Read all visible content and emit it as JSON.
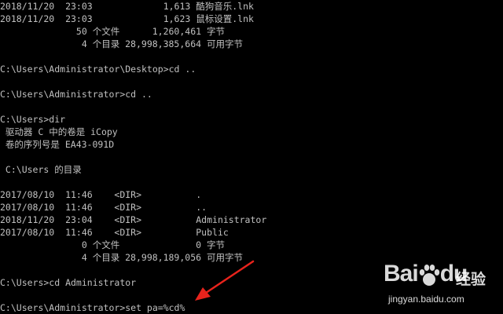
{
  "console": {
    "lines": [
      {
        "text": "2018/11/20  23:03             1,613 酷狗音乐.lnk"
      },
      {
        "text": "2018/11/20  23:03             1,623 鼠标设置.lnk"
      },
      {
        "text": "              50 个文件      1,260,461 字节"
      },
      {
        "text": "               4 个目录 28,998,385,664 可用字节"
      },
      {
        "text": ""
      },
      {
        "text": "C:\\Users\\Administrator\\Desktop>cd .."
      },
      {
        "text": ""
      },
      {
        "text": "C:\\Users\\Administrator>cd .."
      },
      {
        "text": ""
      },
      {
        "text": "C:\\Users>dir"
      },
      {
        "text": " 驱动器 C 中的卷是 iCopy"
      },
      {
        "text": " 卷的序列号是 EA43-091D"
      },
      {
        "text": ""
      },
      {
        "text": " C:\\Users 的目录"
      },
      {
        "text": ""
      },
      {
        "text": "2017/08/10  11:46    <DIR>          ."
      },
      {
        "text": "2017/08/10  11:46    <DIR>          .."
      },
      {
        "text": "2018/11/20  23:04    <DIR>          Administrator"
      },
      {
        "text": "2017/08/10  11:46    <DIR>          Public"
      },
      {
        "text": "               0 个文件              0 字节"
      },
      {
        "text": "               4 个目录 28,998,189,056 可用字节"
      },
      {
        "text": ""
      },
      {
        "text": "C:\\Users>cd Administrator"
      },
      {
        "text": ""
      },
      {
        "text": "C:\\Users\\Administrator>set pa=%cd%"
      }
    ]
  },
  "annotation": {
    "icon": "red-arrow-icon",
    "color": "#e8231c"
  },
  "watermark": {
    "logo_text": "Bai",
    "logo_suffix": "du",
    "paw_icon": "baidu-paw-icon",
    "chinese": "经验",
    "url": "jingyan.baidu.com"
  },
  "colors": {
    "background": "#000000",
    "text": "#c0c0c0"
  }
}
